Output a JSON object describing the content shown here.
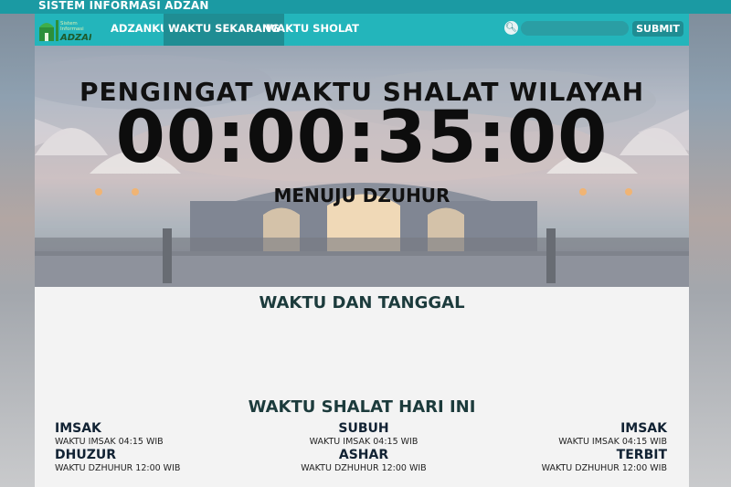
{
  "topbar": {
    "title": "SISTEM INFORMASI ADZAN"
  },
  "logo": {
    "line1": "Sistem",
    "line2": "Informasi",
    "line3": "ADZAN"
  },
  "nav": {
    "items": [
      {
        "label": "ADZANKU"
      },
      {
        "label": "WAKTU SEKARANG"
      },
      {
        "label": "WAKTU SHOLAT"
      }
    ]
  },
  "search": {
    "placeholder": "",
    "submit_label": "SUBMIT"
  },
  "hero": {
    "title": "PENGINGAT WAKTU SHALAT WILAYAH",
    "countdown": "00:00:35:00",
    "subtitle": "MENUJU DZUHUR"
  },
  "sections": {
    "date_title": "WAKTU DAN TANGGAL",
    "today_title": "WAKTU SHALAT HARI INI"
  },
  "prayers": [
    {
      "name": "IMSAK",
      "time": "WAKTU IMSAK 04:15 WIB"
    },
    {
      "name": "SUBUH",
      "time": "WAKTU IMSAK 04:15 WIB"
    },
    {
      "name": "IMSAK",
      "time": "WAKTU IMSAK 04:15 WIB"
    },
    {
      "name": "DHUZUR",
      "time": "WAKTU DZHUHUR 12:00 WIB"
    },
    {
      "name": "ASHAR",
      "time": "WAKTU DZHUHUR 12:00 WIB"
    },
    {
      "name": "TERBIT",
      "time": "WAKTU DZHUHUR 12:00 WIB"
    }
  ],
  "colors": {
    "topbar": "#1b9aa3",
    "navbar": "#23b5bb",
    "nav_active": "#1f8d93"
  }
}
